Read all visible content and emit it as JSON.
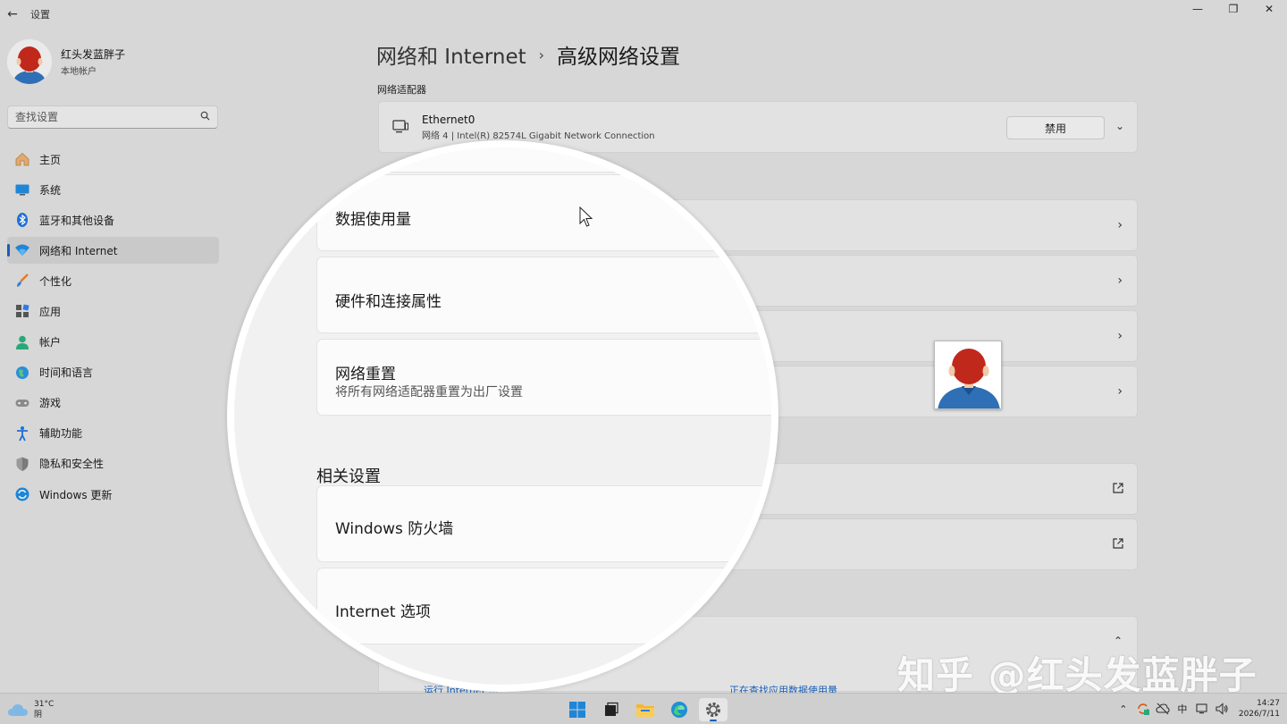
{
  "window": {
    "title": "设置",
    "back_icon": "back-arrow-icon",
    "controls": [
      "—",
      "❐",
      "✕"
    ]
  },
  "profile": {
    "name": "红头发蓝胖子",
    "account_type": "本地帐户"
  },
  "search": {
    "placeholder": "查找设置",
    "icon": "search-icon"
  },
  "sidebar": {
    "items": [
      {
        "label": "主页",
        "icon": "home-icon"
      },
      {
        "label": "系统",
        "icon": "system-icon"
      },
      {
        "label": "蓝牙和其他设备",
        "icon": "bluetooth-icon"
      },
      {
        "label": "网络和 Internet",
        "icon": "network-icon",
        "active": true
      },
      {
        "label": "个性化",
        "icon": "brush-icon"
      },
      {
        "label": "应用",
        "icon": "apps-icon"
      },
      {
        "label": "帐户",
        "icon": "account-icon"
      },
      {
        "label": "时间和语言",
        "icon": "globe-icon"
      },
      {
        "label": "游戏",
        "icon": "gamepad-icon"
      },
      {
        "label": "辅助功能",
        "icon": "accessibility-icon"
      },
      {
        "label": "隐私和安全性",
        "icon": "shield-icon"
      },
      {
        "label": "Windows 更新",
        "icon": "update-icon"
      }
    ]
  },
  "header": {
    "parent": "网络和 Internet",
    "separator": "›",
    "title": "高级网络设置"
  },
  "adapters": {
    "section_label": "网络适配器",
    "ethernet": {
      "name": "Ethernet0",
      "description": "网络 4 | Intel(R) 82574L Gigabit Network Connection",
      "button_label": "禁用"
    }
  },
  "magnifier": {
    "rows": [
      {
        "title": "数据使用量"
      },
      {
        "title": "硬件和连接属性"
      },
      {
        "title": "网络重置",
        "subtitle": "将所有网络适配器重置为出厂设置"
      }
    ],
    "related_label": "相关设置",
    "related": [
      {
        "title": "Windows 防火墙"
      },
      {
        "title": "Internet 选项"
      }
    ]
  },
  "bottom_links": {
    "left": "运行 Internet ...",
    "right": "正在查找应用数据使用量"
  },
  "watermark": "知乎 @红头发蓝胖子",
  "taskbar": {
    "weather_temp": "31°C",
    "weather_desc": "阴",
    "ime": "中",
    "time": "14:27",
    "date": "2026/7/11"
  },
  "colors": {
    "accent": "#1a5fb4",
    "avatar_hair": "#c0281c",
    "avatar_shirt": "#2f6fb6"
  }
}
